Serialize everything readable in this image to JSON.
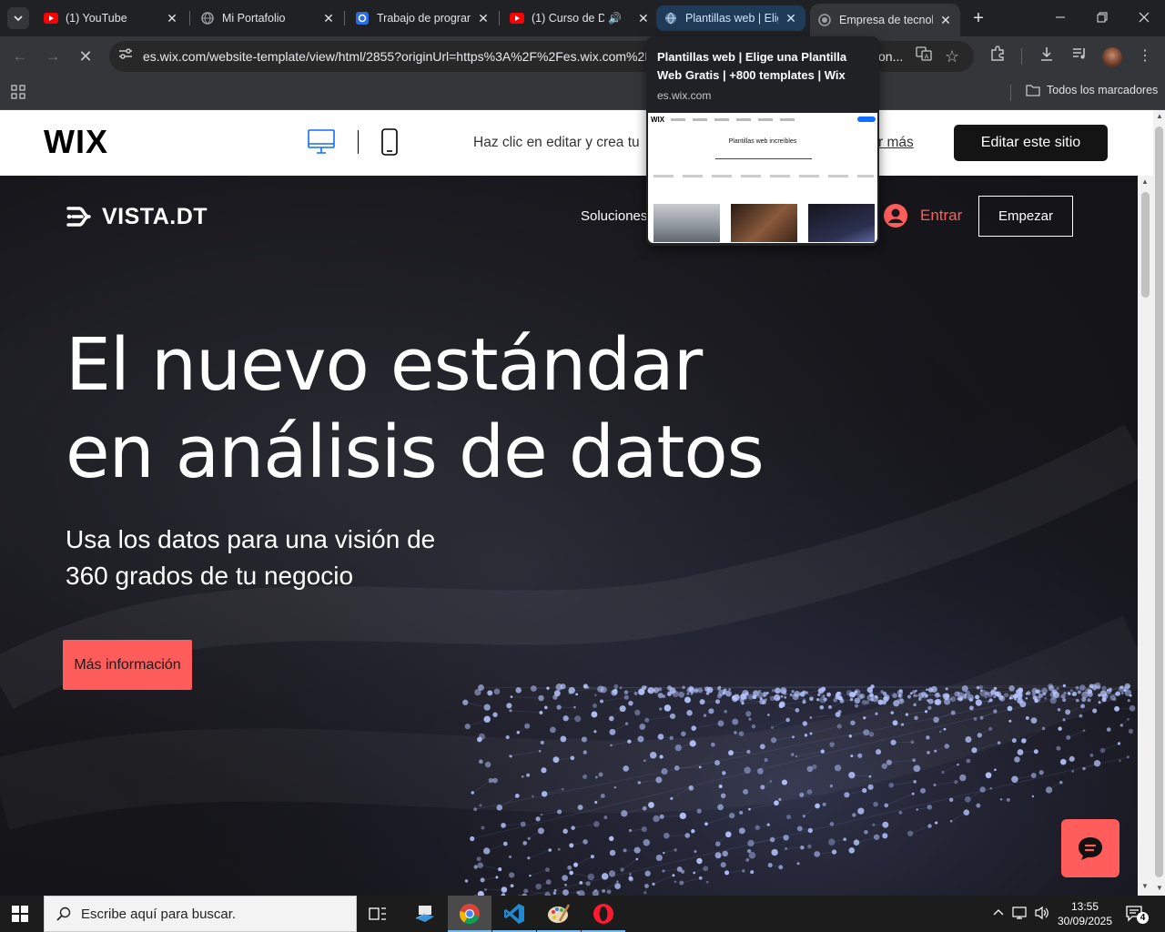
{
  "browser": {
    "tabs": [
      {
        "title": "(1) YouTube",
        "icon": "youtube-icon"
      },
      {
        "title": "Mi Portafolio",
        "icon": "globe-icon"
      },
      {
        "title": "Trabajo de progran",
        "icon": "app-icon"
      },
      {
        "title": "(1) Curso de D",
        "icon": "youtube-icon"
      },
      {
        "title": "Plantillas web | Elig",
        "icon": "globe-icon"
      },
      {
        "title": "Empresa de tecnol",
        "icon": "globe-icon"
      }
    ],
    "url": "es.wix.com/website-template/view/html/2855?originUrl=https%3A%2F%2Fes.wix.com%2F",
    "url_tail": "on...",
    "bookmarks_label": "Todos los marcadores"
  },
  "hovercard": {
    "title": "Plantillas web | Elige una Plantilla Web Gratis | +800 templates | Wix",
    "domain": "es.wix.com",
    "preview_logo": "WIX",
    "preview_heading": "Plantillas web increíbles"
  },
  "wixbar": {
    "logo": "WIX",
    "message": "Haz clic en editar y crea tu",
    "more_link": "r más",
    "edit_button": "Editar este sitio"
  },
  "site": {
    "brand": "VISTA.DT",
    "nav_item": "Soluciones",
    "login": "Entrar",
    "start_button": "Empezar",
    "headline_line1": "El nuevo estándar",
    "headline_line2": "en análisis de datos",
    "subtitle_line1": "Usa los datos para una visión de",
    "subtitle_line2": "360 grados de tu negocio",
    "cta": "Más información",
    "accent": "#ff5c5c"
  },
  "taskbar": {
    "search_placeholder": "Escribe aquí para buscar.",
    "time": "13:55",
    "date": "30/09/2025",
    "notifications": "4"
  }
}
